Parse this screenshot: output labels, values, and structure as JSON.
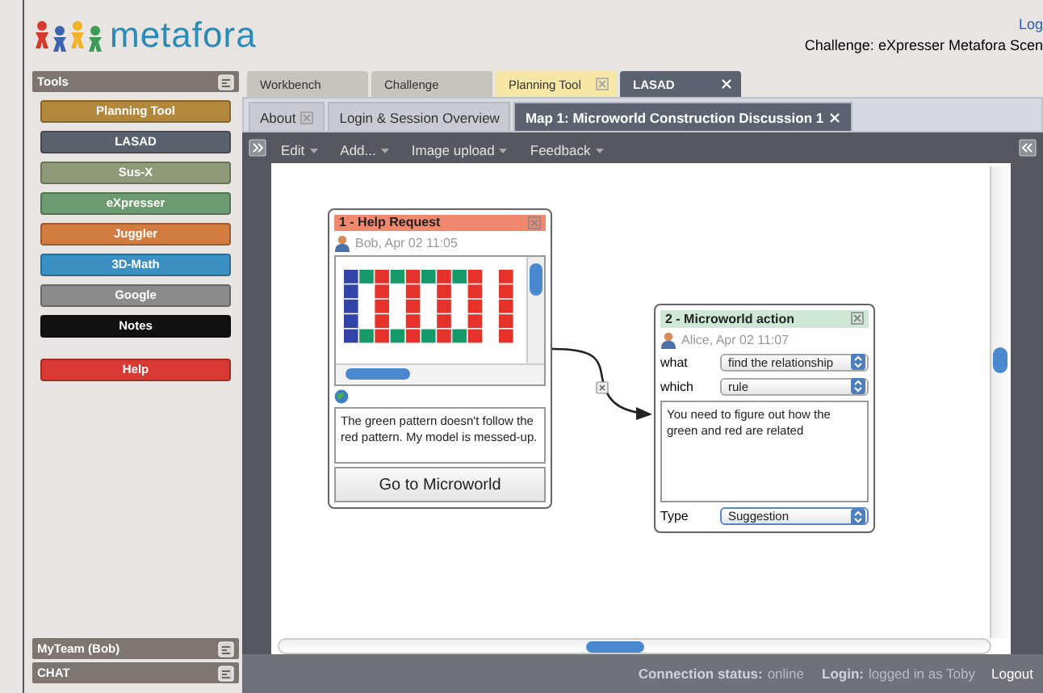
{
  "header": {
    "logo": "metafora",
    "link": "Log",
    "challenge": "Challenge: eXpresser Metafora Scen"
  },
  "sidebar": {
    "title": "Tools",
    "tools": [
      {
        "label": "Planning Tool",
        "color": "#b3873c"
      },
      {
        "label": "LASAD",
        "color": "#5b616d"
      },
      {
        "label": "Sus-X",
        "color": "#8f9a78"
      },
      {
        "label": "eXpresser",
        "color": "#6b9b6f"
      },
      {
        "label": "Juggler",
        "color": "#d27b3f"
      },
      {
        "label": "3D-Math",
        "color": "#3b90c1"
      },
      {
        "label": "Google",
        "color": "#8b8b8b"
      },
      {
        "label": "Notes",
        "color": "#111111"
      }
    ],
    "help": {
      "label": "Help"
    },
    "panels": [
      {
        "label": "MyTeam (Bob)"
      },
      {
        "label": "CHAT"
      }
    ]
  },
  "tabs": [
    {
      "label": "Workbench",
      "selected": false,
      "highlighted": false,
      "closable": false
    },
    {
      "label": "Challenge",
      "selected": false,
      "highlighted": false,
      "closable": false
    },
    {
      "label": "Planning Tool",
      "selected": false,
      "highlighted": true,
      "closable": true
    },
    {
      "label": "LASAD",
      "selected": true,
      "highlighted": false,
      "closable": true
    }
  ],
  "subtabs": [
    {
      "label": "About",
      "selected": false,
      "closable": true
    },
    {
      "label": "Login & Session Overview",
      "selected": false,
      "closable": false
    },
    {
      "label": "Map 1: Microworld Construction Discussion 1",
      "selected": true,
      "closable": true
    }
  ],
  "menu": [
    "Edit",
    "Add...",
    "Image upload",
    "Feedback"
  ],
  "cards": [
    {
      "kind": "help_request",
      "title": "1 - Help Request",
      "color": "#f0896f",
      "author": "Bob, Apr 02 11:05",
      "text": "The green pattern doesn't follow the red pattern.  My model is messed-up.",
      "button": "Go to Microworld"
    },
    {
      "kind": "microworld_action",
      "title": "2 - Microworld action",
      "color": "#cfe8d6",
      "author": "Alice, Apr 02 11:07",
      "fields": [
        {
          "label": "what",
          "value": "find the relationship"
        },
        {
          "label": "which",
          "value": "rule"
        }
      ],
      "text": "You need to figure out how the green and red are related",
      "type_label": "Type",
      "type_value": "Suggestion"
    }
  ],
  "status_bar": {
    "connection_label": "Connection status:",
    "connection_value": "online",
    "login_label": "Login:",
    "login_value": "logged in as Toby",
    "logout": "Logout"
  }
}
